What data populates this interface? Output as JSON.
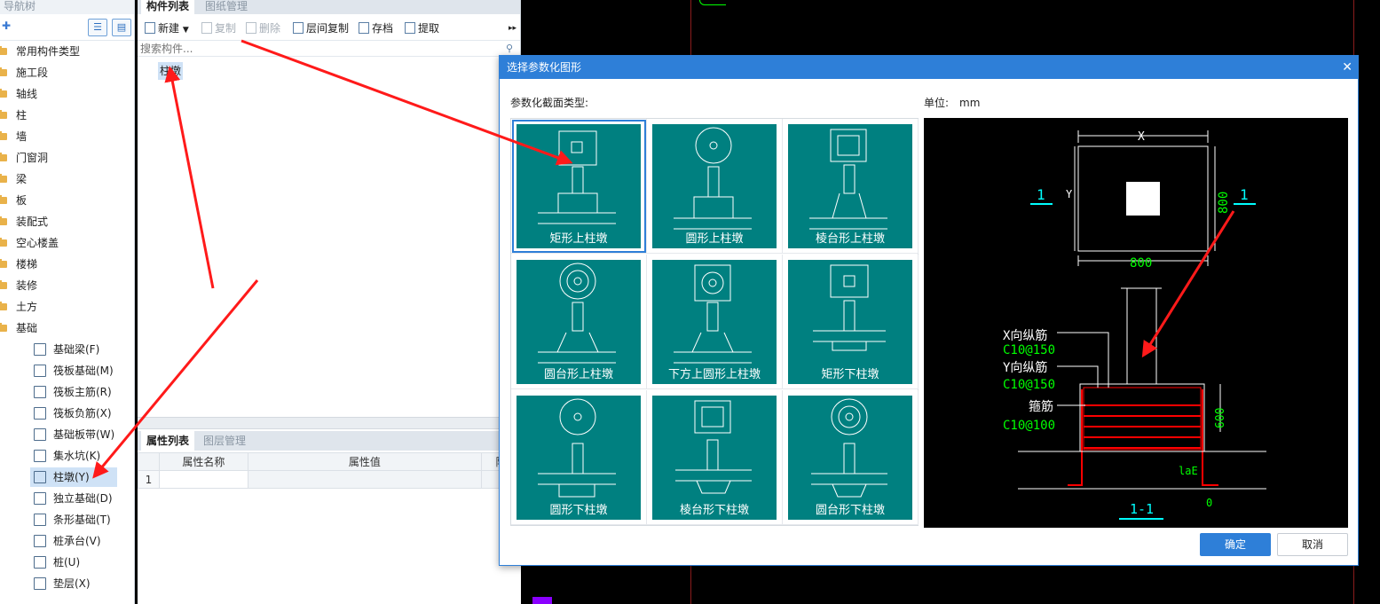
{
  "nav": {
    "title": "导航树",
    "add_icon": "plus-icon",
    "tree": [
      {
        "label": "常用构件类型"
      },
      {
        "label": "施工段"
      },
      {
        "label": "轴线"
      },
      {
        "label": "柱"
      },
      {
        "label": "墙"
      },
      {
        "label": "门窗洞"
      },
      {
        "label": "梁"
      },
      {
        "label": "板"
      },
      {
        "label": "装配式"
      },
      {
        "label": "空心楼盖"
      },
      {
        "label": "楼梯"
      },
      {
        "label": "装修"
      },
      {
        "label": "土方"
      },
      {
        "label": "基础"
      }
    ],
    "foundation_children": [
      {
        "label": "基础梁(F)",
        "icon": "beam-icon"
      },
      {
        "label": "筏板基础(M)",
        "icon": "raft-icon"
      },
      {
        "label": "筏板主筋(R)",
        "icon": "main-rebar-icon"
      },
      {
        "label": "筏板负筋(X)",
        "icon": "negative-rebar-icon"
      },
      {
        "label": "基础板带(W)",
        "icon": "strip-icon"
      },
      {
        "label": "集水坑(K)",
        "icon": "sump-icon"
      },
      {
        "label": "柱墩(Y)",
        "icon": "column-pier-icon",
        "selected": true
      },
      {
        "label": "独立基础(D)",
        "icon": "isolated-footing-icon"
      },
      {
        "label": "条形基础(T)",
        "icon": "strip-footing-icon"
      },
      {
        "label": "桩承台(V)",
        "icon": "pile-cap-icon"
      },
      {
        "label": "桩(U)",
        "icon": "pile-icon"
      },
      {
        "label": "垫层(X)",
        "icon": "cushion-icon"
      }
    ]
  },
  "component_panel": {
    "tabs": [
      "构件列表",
      "图纸管理"
    ],
    "toolbar": [
      {
        "label": "新建",
        "enabled": true
      },
      {
        "label": "复制",
        "enabled": false
      },
      {
        "label": "删除",
        "enabled": false
      },
      {
        "label": "层间复制",
        "enabled": true
      },
      {
        "label": "存档",
        "enabled": true
      },
      {
        "label": "提取",
        "enabled": true
      }
    ],
    "search_placeholder": "搜索构件...",
    "items": [
      "柱墩"
    ]
  },
  "property_panel": {
    "tabs": [
      "属性列表",
      "图层管理"
    ],
    "columns": [
      "属性名称",
      "属性值",
      "附"
    ],
    "rows": [
      {
        "no": "1",
        "name": "",
        "value": ""
      }
    ]
  },
  "dialog": {
    "title": "选择参数化图形",
    "section_label": "参数化截面类型:",
    "unit_label": "单位:",
    "unit_value": "mm",
    "shapes": [
      {
        "label": "矩形上柱墩",
        "selected": true
      },
      {
        "label": "圆形上柱墩"
      },
      {
        "label": "棱台形上柱墩"
      },
      {
        "label": "圆台形上柱墩"
      },
      {
        "label": "下方上圆形上柱墩"
      },
      {
        "label": "矩形下柱墩"
      },
      {
        "label": "圆形下柱墩"
      },
      {
        "label": "棱台形下柱墩"
      },
      {
        "label": "圆台形下柱墩"
      }
    ],
    "preview": {
      "dim_x": "X",
      "dim_y": "Y",
      "dim_width": "800",
      "dim_height": "800",
      "section_mark": "1",
      "x_rebar_label": "X向纵筋",
      "x_rebar_value": "C10@150",
      "y_rebar_label": "Y向纵筋",
      "y_rebar_value": "C10@150",
      "stirrup_label": "箍筋",
      "stirrup_value": "C10@100",
      "dim_depth": "600",
      "anchor_label": "laE",
      "zero_label": "0",
      "section_title": "1-1"
    },
    "ok_label": "确定",
    "cancel_label": "取消"
  },
  "colors": {
    "dialog_title_bg": "#2e7fd8",
    "tile_bg": "#008080",
    "annotation_arrow": "#ff1a1a",
    "preview_cyan": "#00ffff",
    "preview_green": "#00ff00",
    "preview_red": "#ff0000"
  }
}
